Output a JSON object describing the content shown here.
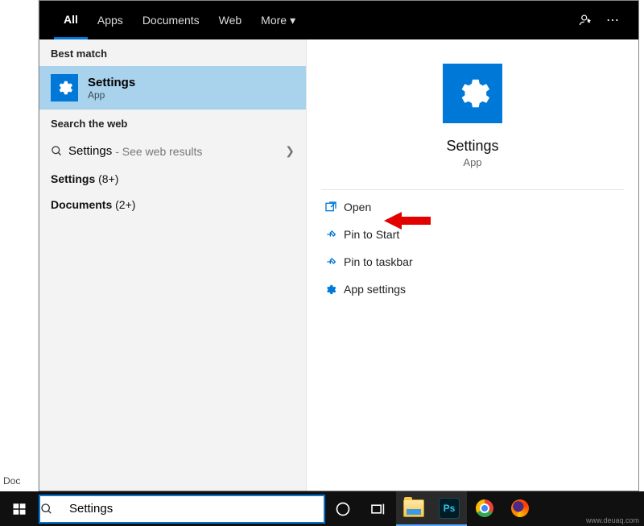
{
  "tabs": {
    "all": "All",
    "apps": "Apps",
    "documents": "Documents",
    "web": "Web",
    "more": "More"
  },
  "sections": {
    "best_match": "Best match",
    "search_web": "Search the web"
  },
  "best": {
    "title": "Settings",
    "sub": "App"
  },
  "webrow": {
    "label": "Settings",
    "hint": " - See web results"
  },
  "groups": {
    "settings_label": "Settings",
    "settings_count": " (8+)",
    "documents_label": "Documents",
    "documents_count": " (2+)"
  },
  "preview": {
    "title": "Settings",
    "sub": "App"
  },
  "actions": {
    "open": "Open",
    "pin_start": "Pin to Start",
    "pin_taskbar": "Pin to taskbar",
    "app_settings": "App settings"
  },
  "search": {
    "value": "Settings"
  },
  "left_edge": {
    "doc": "Doc"
  },
  "ps_label": "Ps",
  "watermark": "www.deuaq.com"
}
